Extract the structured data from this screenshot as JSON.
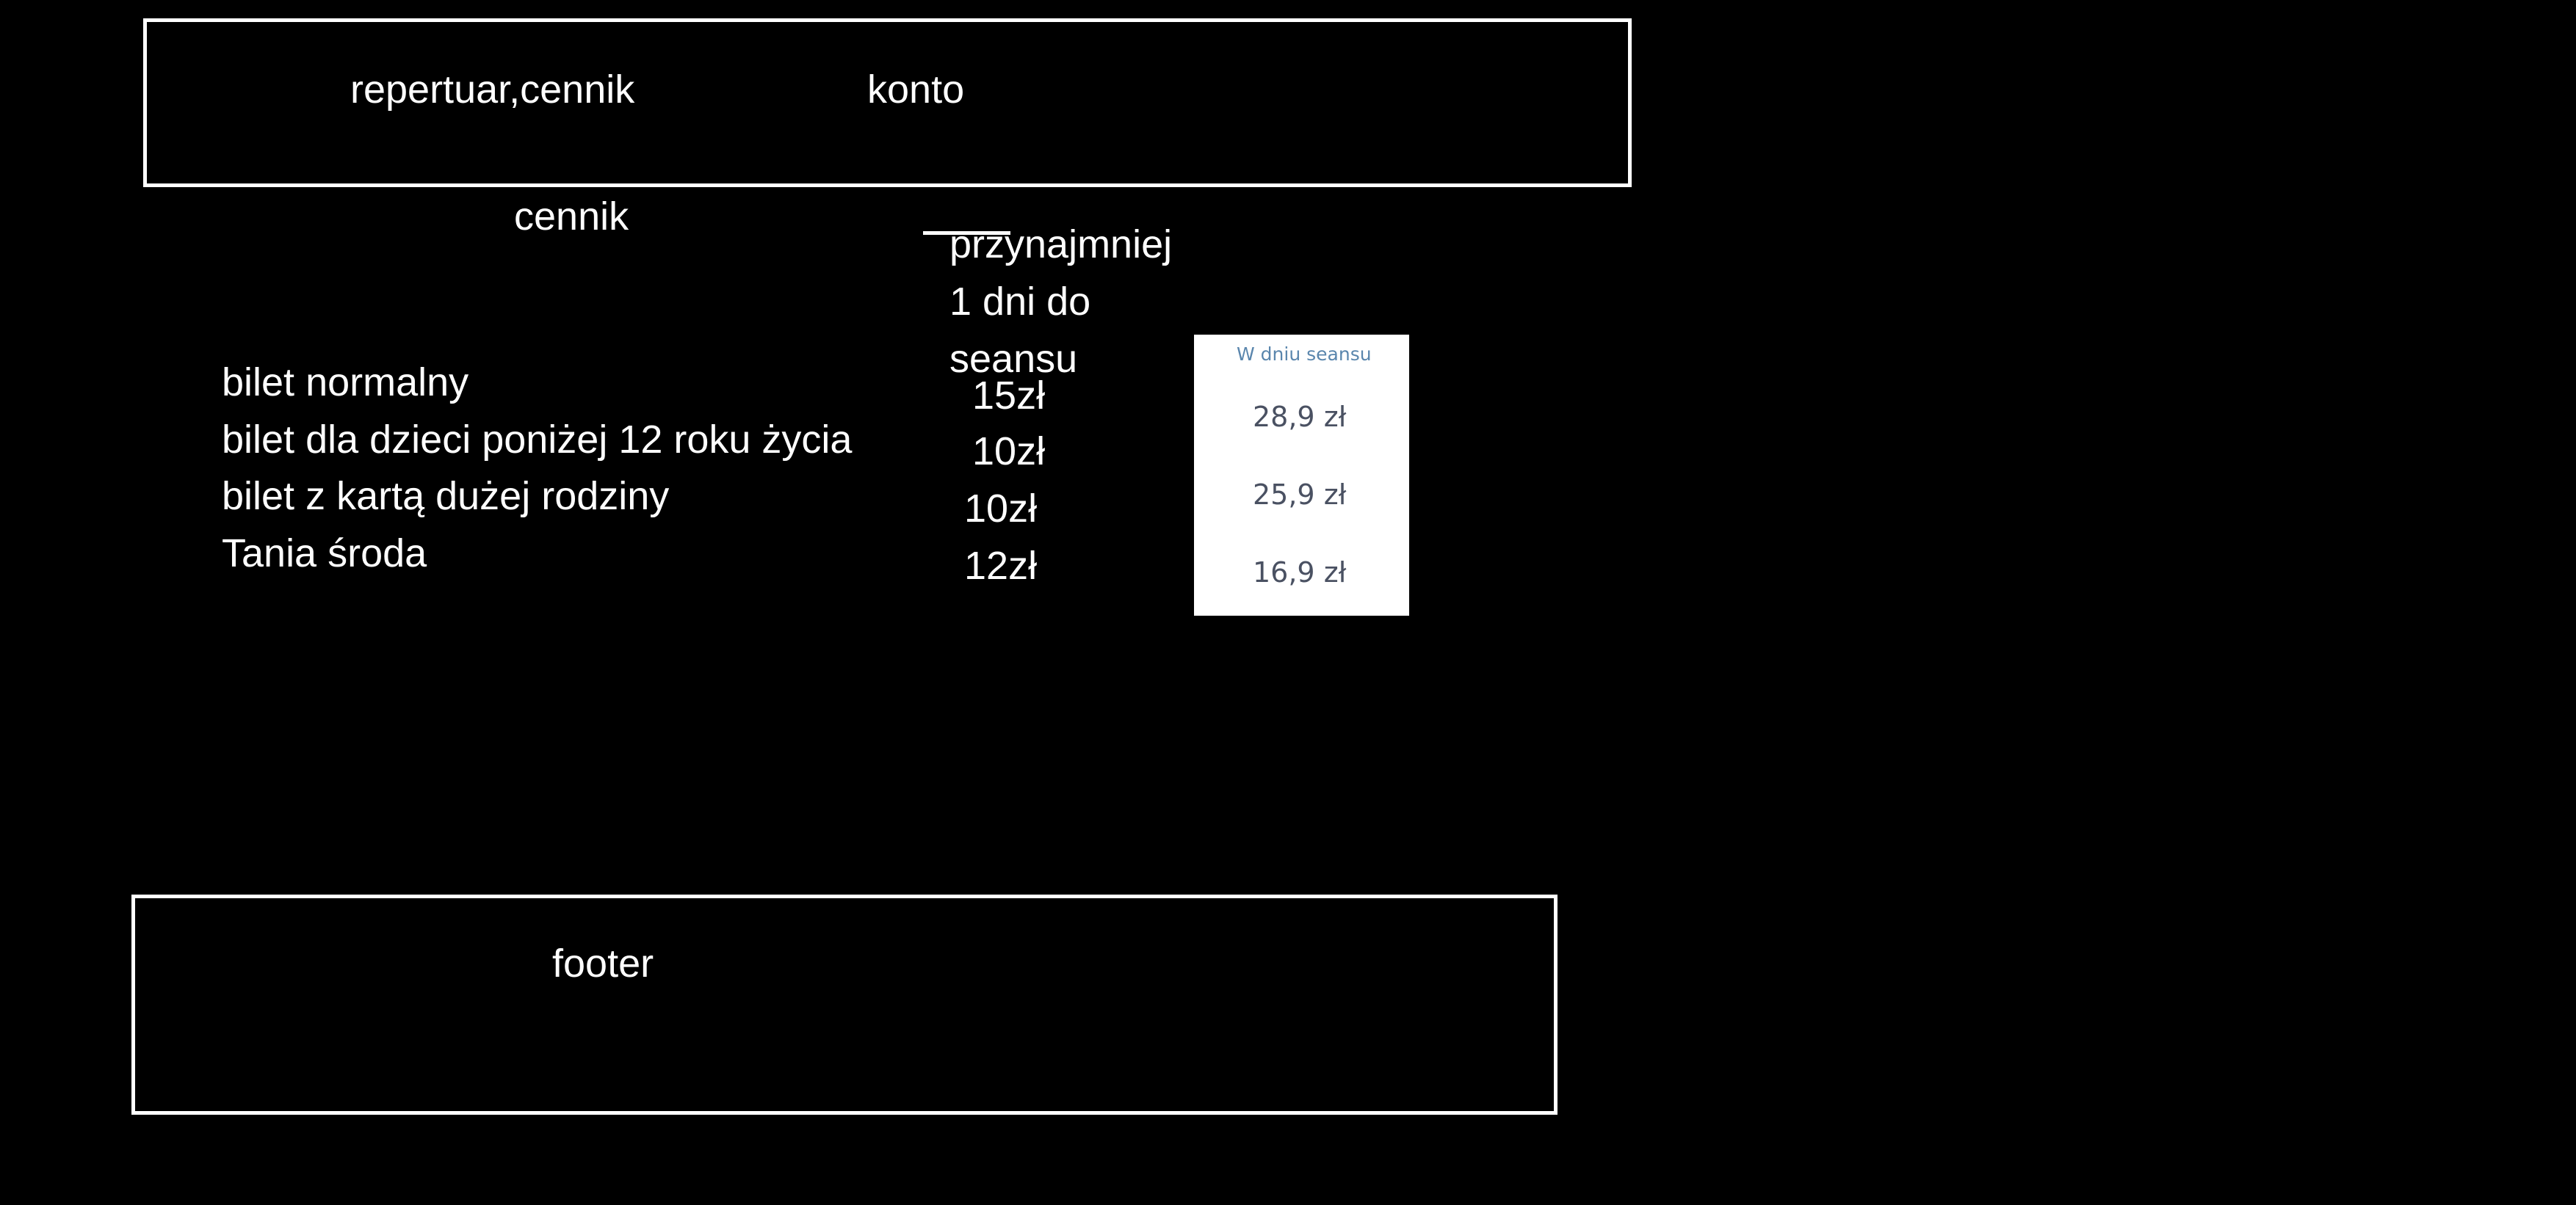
{
  "header": {
    "nav_repertuar": "repertuar,cennik",
    "nav_konto": "konto"
  },
  "main": {
    "section_title": "cennik",
    "column_header_lines": [
      "przynajmniej",
      "1 dni do",
      "seansu"
    ],
    "tickets": [
      {
        "name": "bilet normalny",
        "price": "15zł"
      },
      {
        "name": "bilet dla dzieci poniżej 12 roku życia",
        "price": "10zł"
      },
      {
        "name": "bilet z kartą dużej rodziny",
        "price": "10zł"
      },
      {
        "name": "Tania środa",
        "price": "12zł"
      }
    ],
    "same_day_panel": {
      "header": "W dniu seansu",
      "prices": [
        "28,9 zł",
        "25,9 zł",
        "16,9 zł"
      ]
    }
  },
  "footer": {
    "label": "footer"
  }
}
